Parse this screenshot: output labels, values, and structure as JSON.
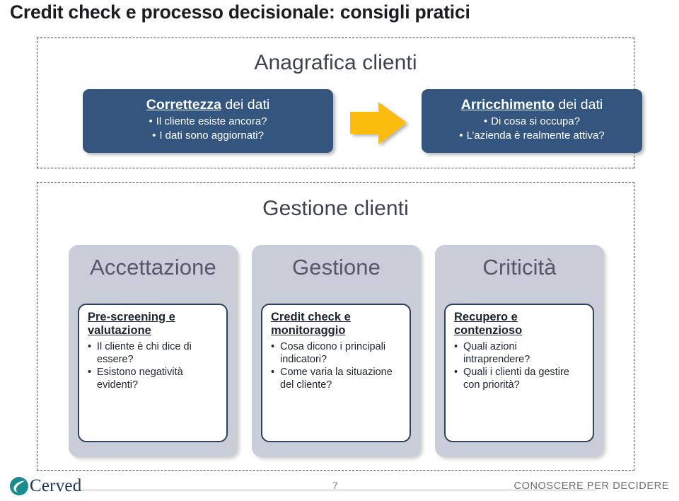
{
  "slide": {
    "title": "Credit check e processo decisionale: consigli pratici",
    "page_number": "7"
  },
  "top_panel": {
    "heading": "Anagrafica clienti",
    "left_box": {
      "title_keyword": "Correttezza",
      "title_rest": " dei dati",
      "bullets": [
        "Il cliente esiste ancora?",
        "I dati sono aggiornati?"
      ]
    },
    "arrow": {
      "icon": "arrow-right-icon",
      "color": "#FBBC0A"
    },
    "right_box": {
      "title_keyword": "Arricchimento",
      "title_rest": " dei dati",
      "bullets": [
        "Di cosa si occupa?",
        "L’azienda è realmente attiva?"
      ]
    }
  },
  "bottom_panel": {
    "heading": "Gestione clienti",
    "columns": [
      {
        "title": "Accettazione",
        "card": {
          "title": "Pre-screening e valutazione",
          "bullets": [
            "Il cliente è chi dice di essere?",
            "Esistono negatività evidenti?"
          ]
        }
      },
      {
        "title": "Gestione",
        "card": {
          "title": "Credit check e monitoraggio",
          "bullets": [
            "Cosa dicono i principali indicatori?",
            "Come varia la situazione del cliente?"
          ]
        }
      },
      {
        "title": "Criticità",
        "card": {
          "title": "Recupero e contenzioso",
          "bullets": [
            "Quali azioni intraprendere?",
            "Quali i clienti da gestire con priorità?"
          ]
        }
      }
    ]
  },
  "footer": {
    "logo_text": "Cerved",
    "logo_icon": "cerved-swoosh-logo-icon",
    "tagline": "CONOSCERE PER DECIDERE"
  },
  "colors": {
    "blue_box": "#33557E",
    "gray_panel": "#C9CDD7",
    "card_border": "#2D4260",
    "arrow_yellow": "#FBBC0A",
    "logo_teal": "#1A8C8C",
    "logo_navy": "#1F3560"
  }
}
